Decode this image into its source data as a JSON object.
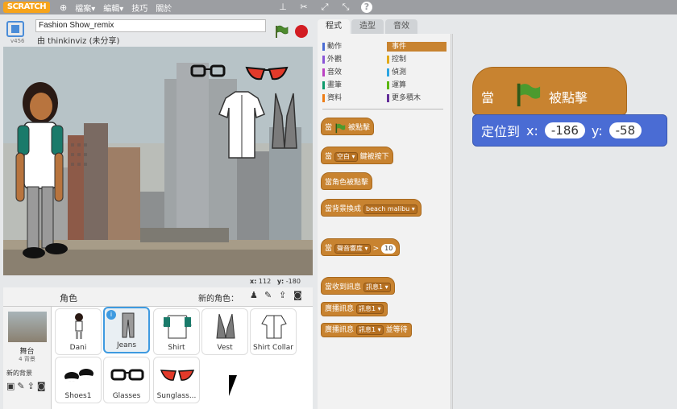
{
  "app": {
    "logo": "SCRATCH",
    "menu": [
      "檔案▾",
      "編輯▾",
      "技巧",
      "關於"
    ],
    "version": "v456"
  },
  "project": {
    "title": "Fashion Show_remix",
    "byline": "由 thinkinviz (未分享)"
  },
  "stage": {
    "coord_x_label": "x:",
    "coord_x": "112",
    "coord_y_label": "y:",
    "coord_y": "-180"
  },
  "sprites_panel": {
    "header": "角色",
    "new_sprite_label": "新的角色：",
    "stage_label": "舞台",
    "stage_sub": "4 背景",
    "new_backdrop_label": "新的背景",
    "sprites": [
      {
        "name": "Dani"
      },
      {
        "name": "Jeans"
      },
      {
        "name": "Shirt"
      },
      {
        "name": "Vest"
      },
      {
        "name": "Shirt Collar"
      },
      {
        "name": "Shoes1"
      },
      {
        "name": "Glasses"
      },
      {
        "name": "Sunglass..."
      }
    ]
  },
  "tabs": [
    "程式",
    "造型",
    "音效"
  ],
  "categories": [
    {
      "label": "動作",
      "color": "#4a6cd4"
    },
    {
      "label": "事件",
      "color": "#c88330"
    },
    {
      "label": "外觀",
      "color": "#8a55d7"
    },
    {
      "label": "控制",
      "color": "#e1a91a"
    },
    {
      "label": "音效",
      "color": "#bb42c3"
    },
    {
      "label": "偵測",
      "color": "#2ca5e2"
    },
    {
      "label": "畫筆",
      "color": "#0e9a6c"
    },
    {
      "label": "運算",
      "color": "#5cb712"
    },
    {
      "label": "資料",
      "color": "#ee7d16"
    },
    {
      "label": "更多積木",
      "color": "#632d99"
    }
  ],
  "blocks": {
    "when_flag_a": "當",
    "when_flag_b": "被點擊",
    "when_key_a": "當",
    "when_key_dd": "空白",
    "when_key_b": "鍵被按下",
    "when_sprite": "當角色被點擊",
    "when_backdrop_a": "當背景換成",
    "when_backdrop_dd": "beach malibu",
    "when_loud_a": "當",
    "when_loud_dd": "聲音響度",
    "when_loud_op": ">",
    "when_loud_val": "10",
    "when_msg_a": "當收到訊息",
    "when_msg_dd": "訊息1",
    "broadcast_a": "廣播訊息",
    "broadcast_dd": "訊息1",
    "broadcast_wait_a": "廣播訊息",
    "broadcast_wait_dd": "訊息1",
    "broadcast_wait_b": "並等待"
  },
  "script": {
    "hat_a": "當",
    "hat_b": "被點擊",
    "goto_label": "定位到",
    "x_label": "x:",
    "x_val": "-186",
    "y_label": "y:",
    "y_val": "-58"
  }
}
